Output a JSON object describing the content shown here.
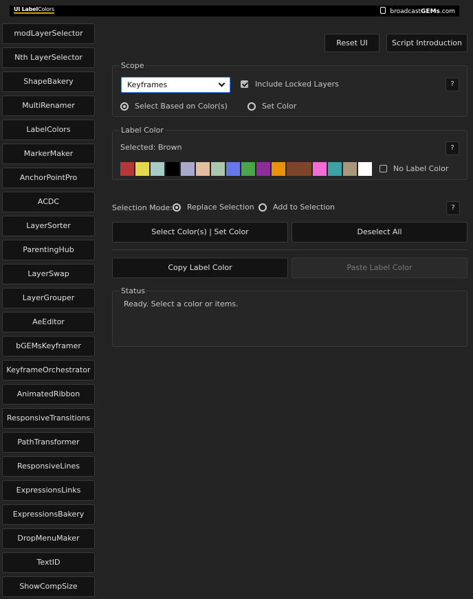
{
  "header": {
    "app_logo_main": "UI Label",
    "app_logo_sub": "Colors",
    "brand_prefix": "broadcast",
    "brand_bold": "GEMs",
    "brand_suffix": ".com"
  },
  "sidebar": {
    "items": [
      "modLayerSelector",
      "Nth LayerSelector",
      "ShapeBakery",
      "MultiRenamer",
      "LabelColors",
      "MarkerMaker",
      "AnchorPointPro",
      "ACDC",
      "LayerSorter",
      "ParentingHub",
      "LayerSwap",
      "LayerGrouper",
      "AeEditor",
      "bGEMsKeyframer",
      "KeyframeOrchestrator",
      "AnimatedRibbon",
      "ResponsiveTransitions",
      "PathTransformer",
      "ResponsiveLines",
      "ExpressionsLinks",
      "ExpressionsBakery",
      "DropMenuMaker",
      "TextID",
      "ShowCompSize"
    ]
  },
  "toolbar": {
    "reset_label": "Reset UI",
    "intro_label": "Script Introduction"
  },
  "scope": {
    "title": "Scope",
    "dropdown_value": "Keyframes",
    "include_locked_label": "Include Locked Layers",
    "include_locked_checked": true,
    "radio_select_label": "Select Based on Color(s)",
    "radio_set_label": "Set Color",
    "help": "?"
  },
  "label_color": {
    "title": "Label Color",
    "selected_text": "Selected: Brown",
    "no_label_label": "No Label Color",
    "help": "?",
    "swatches": [
      {
        "color": "#b53838",
        "w": 20
      },
      {
        "color": "#e4d84c",
        "w": 20
      },
      {
        "color": "#a9cbc7",
        "w": 20
      },
      {
        "color": "#000000",
        "w": 20
      },
      {
        "color": "#a8a9cc",
        "w": 20
      },
      {
        "color": "#e5bc9f",
        "w": 20
      },
      {
        "color": "#a9c8ad",
        "w": 20
      },
      {
        "color": "#6578e5",
        "w": 20
      },
      {
        "color": "#4aa44b",
        "w": 20
      },
      {
        "color": "#8e2c9a",
        "w": 20
      },
      {
        "color": "#e8920d",
        "w": 20
      },
      {
        "color": "#7f452a",
        "w": 36
      },
      {
        "color": "#f46dd6",
        "w": 20
      },
      {
        "color": "#3da2a5",
        "w": 20
      },
      {
        "color": "#a8977b",
        "w": 20
      },
      {
        "color": "#ffffff",
        "w": 20
      }
    ]
  },
  "selection_mode": {
    "label": "Selection Mode:",
    "replace_label": "Replace Selection",
    "add_label": "Add to Selection",
    "help": "?"
  },
  "actions": {
    "select_set_label": "Select Color(s) | Set Color",
    "deselect_label": "Deselect All",
    "copy_label": "Copy Label Color",
    "paste_label": "Paste Label Color"
  },
  "status": {
    "title": "Status",
    "text": "Ready. Select a color or items."
  }
}
